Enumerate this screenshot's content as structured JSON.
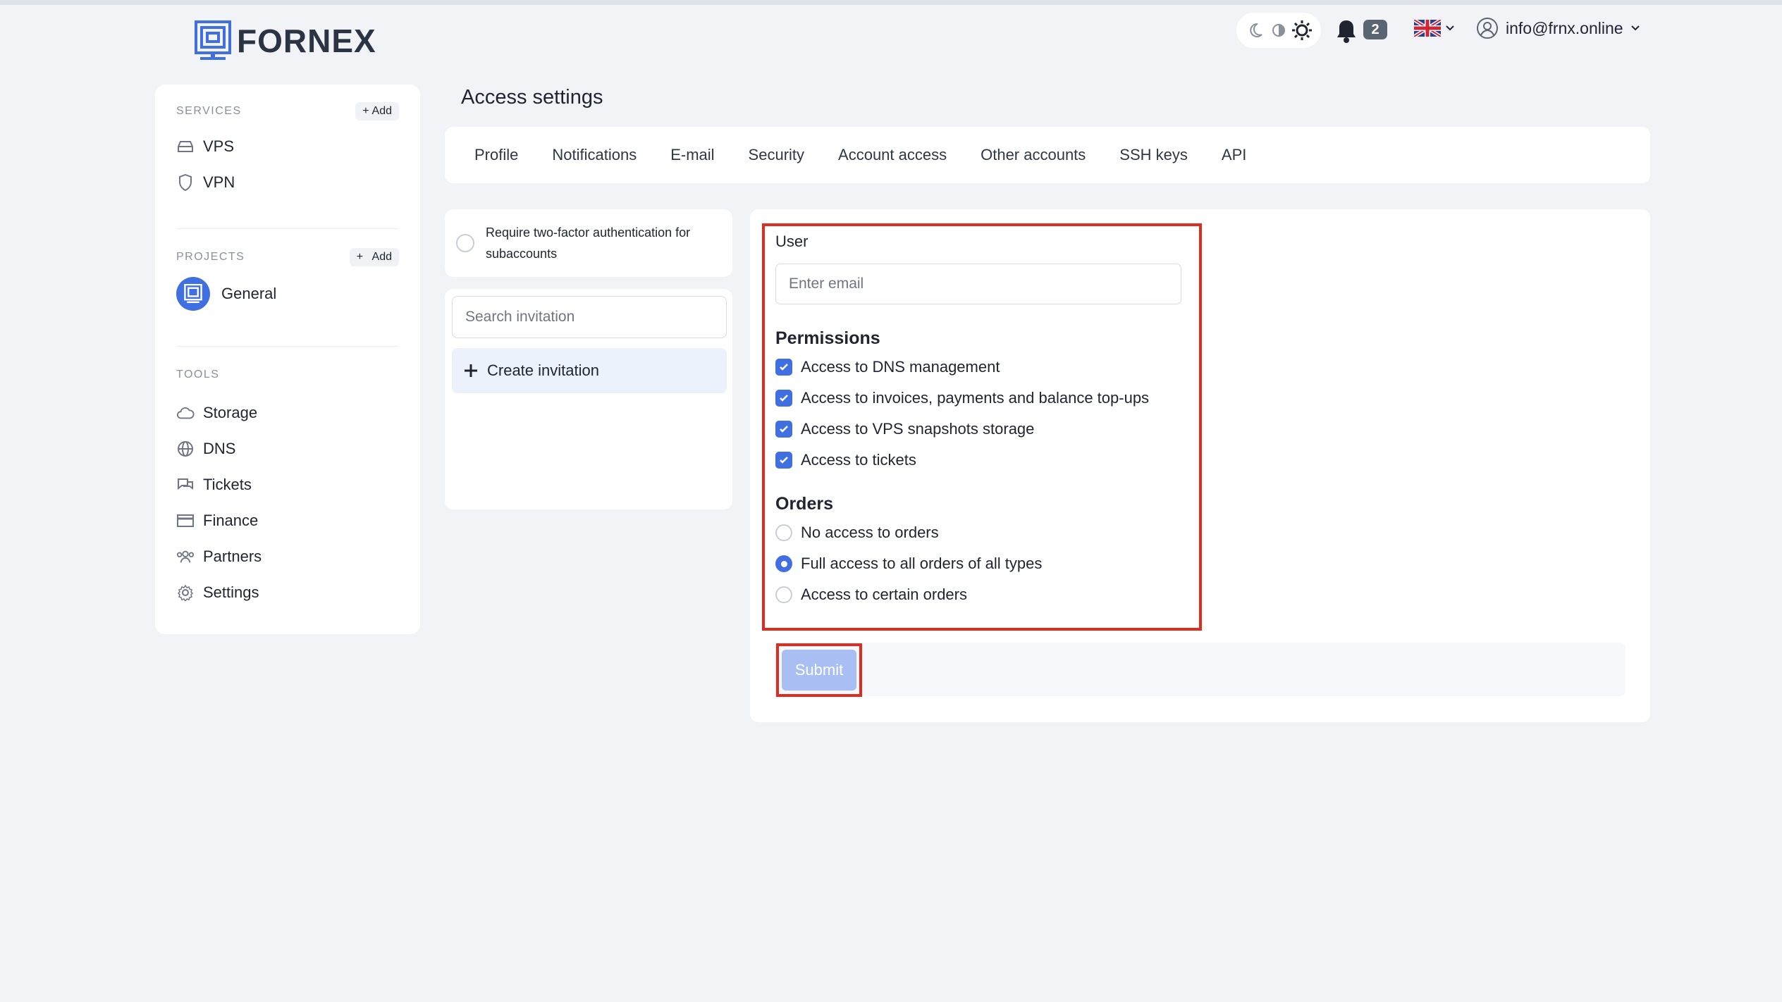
{
  "brand": {
    "name": "FORNEX"
  },
  "header": {
    "notifications_count": "2",
    "user_email": "info@frnx.online"
  },
  "sidebar": {
    "services": {
      "title": "SERVICES",
      "add_label": "Add",
      "items": [
        {
          "label": "VPS",
          "icon": "drive-icon"
        },
        {
          "label": "VPN",
          "icon": "shield-icon"
        }
      ]
    },
    "projects": {
      "title": "PROJECTS",
      "add_label": "Add",
      "items": [
        {
          "label": "General",
          "icon": "project-icon"
        }
      ]
    },
    "tools": {
      "title": "TOOLS",
      "items": [
        {
          "label": "Storage",
          "icon": "cloud-icon"
        },
        {
          "label": "DNS",
          "icon": "globe-icon"
        },
        {
          "label": "Tickets",
          "icon": "chat-icon"
        },
        {
          "label": "Finance",
          "icon": "card-icon"
        },
        {
          "label": "Partners",
          "icon": "people-icon"
        },
        {
          "label": "Settings",
          "icon": "gear-icon"
        }
      ]
    }
  },
  "main": {
    "title": "Access settings",
    "tabs": [
      "Profile",
      "Notifications",
      "E-mail",
      "Security",
      "Account access",
      "Other accounts",
      "SSH keys",
      "API"
    ],
    "two_factor": {
      "label": "Require two-factor authentication for subaccounts",
      "checked": false
    },
    "invitations": {
      "search_placeholder": "Search invitation",
      "create_label": "Create invitation"
    },
    "form": {
      "user_label": "User",
      "email_placeholder": "Enter email",
      "permissions_title": "Permissions",
      "permissions": [
        {
          "label": "Access to DNS management",
          "checked": true
        },
        {
          "label": "Access to invoices, payments and balance top-ups",
          "checked": true
        },
        {
          "label": "Access to VPS snapshots storage",
          "checked": true
        },
        {
          "label": "Access to tickets",
          "checked": true
        }
      ],
      "orders_title": "Orders",
      "orders": [
        {
          "label": "No access to orders",
          "selected": false
        },
        {
          "label": "Full access to all orders of all types",
          "selected": true
        },
        {
          "label": "Access to certain orders",
          "selected": false
        }
      ],
      "submit_label": "Submit"
    }
  },
  "colors": {
    "accent": "#3f6fe0",
    "highlight": "#e02b1f",
    "submit_disabled": "#a9bff4",
    "background": "#f1f3f7"
  }
}
